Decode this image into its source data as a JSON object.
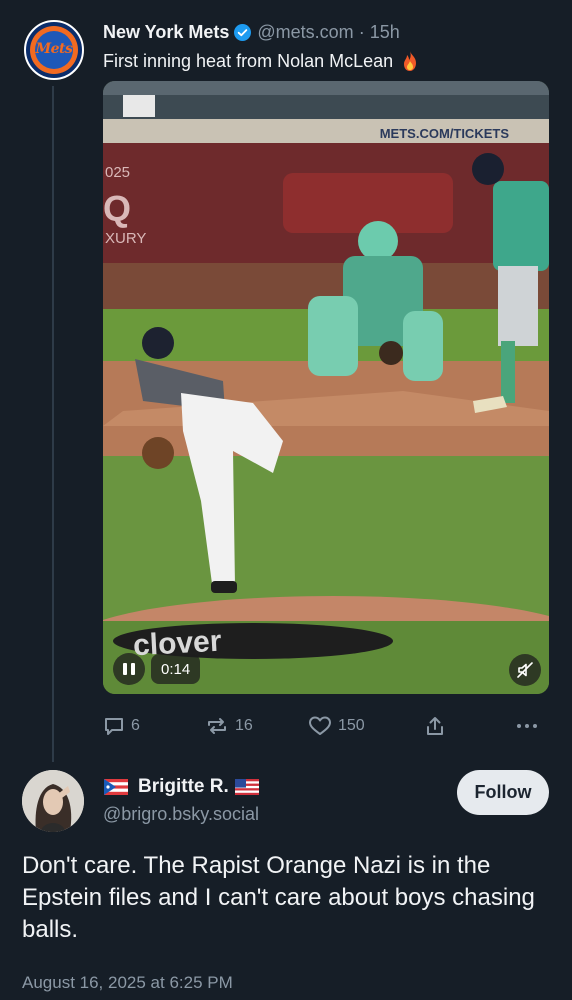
{
  "post": {
    "display_name": "New York Mets",
    "handle": "@mets.com",
    "separator": "·",
    "time": "15h",
    "text": "First inning heat from Nolan McLean",
    "emoji_icon": "fire-icon",
    "avatar_text": "Mets",
    "video": {
      "banner_text": "METS.COM/TICKETS",
      "ad_year": "025",
      "ad_letter": "Q",
      "ad_word": "XURY",
      "mound_text": "clover",
      "time_label": "0:14",
      "state": "playing",
      "muted": true
    },
    "actions": {
      "replies": "6",
      "reposts": "16",
      "likes": "150"
    }
  },
  "reply": {
    "display_name": "Brigitte R.",
    "handle": "@brigro.bsky.social",
    "follow_label": "Follow",
    "text": "Don't care. The Rapist Orange Nazi is in the Epstein files and I can't care about boys chasing balls.",
    "timestamp": "August 16, 2025 at 6:25 PM"
  },
  "colors": {
    "background": "#161e27",
    "muted_text": "#8b98a5",
    "verified_blue": "#1d9bf0",
    "follow_bg": "#e6eaee"
  }
}
